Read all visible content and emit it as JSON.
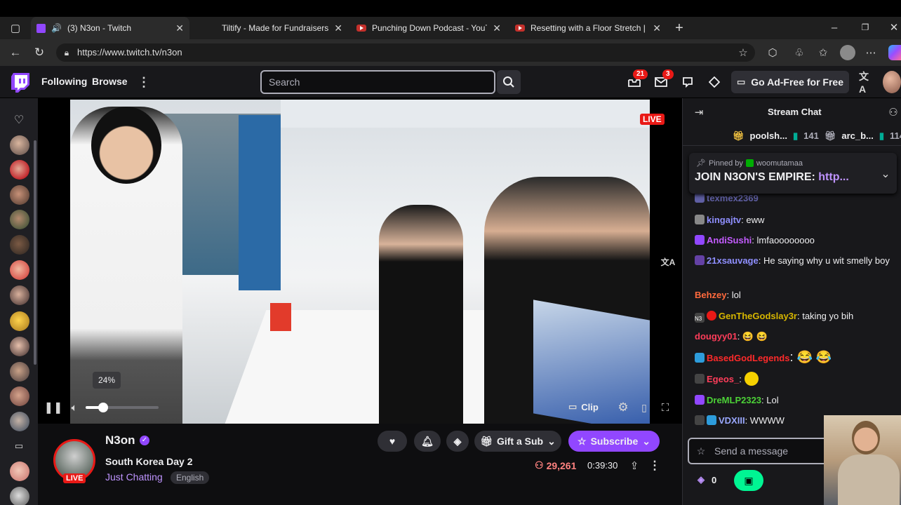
{
  "browser": {
    "tabs": [
      {
        "title": "(3) N3on - Twitch",
        "active": true,
        "favicon": "twitch-icon"
      },
      {
        "title": "Tiltify - Made for Fundraisers",
        "active": false,
        "favicon": "tiltify-icon"
      },
      {
        "title": "Punching Down Podcast - YouTub",
        "active": false,
        "favicon": "youtube-icon"
      },
      {
        "title": "Resetting with a Floor Stretch | Za",
        "active": false,
        "favicon": "youtube-icon"
      }
    ],
    "url": "https://www.twitch.tv/n3on"
  },
  "twitch_nav": {
    "following": "Following",
    "browse": "Browse",
    "search_placeholder": "Search",
    "notifications_count": "21",
    "inbox_count": "3",
    "ad_free": "Go Ad-Free for Free"
  },
  "player": {
    "live_badge": "LIVE",
    "volume_tooltip": "24%",
    "volume_level": 0.24,
    "clip_label": "Clip"
  },
  "channel": {
    "name": "N3on",
    "title": "South Korea Day 2",
    "category": "Just Chatting",
    "tag": "English",
    "live_badge": "LIVE",
    "viewers": "29,261",
    "uptime": "0:39:30",
    "gift_sub": "Gift a Sub",
    "subscribe": "Subscribe"
  },
  "chat": {
    "header": "Stream Chat",
    "gifters": [
      {
        "name": "poolsh...",
        "count": "141"
      },
      {
        "name": "arc_b...",
        "count": "114"
      }
    ],
    "pinned_by_label": "Pinned by",
    "pinned_by_user": "woomutamaa",
    "pinned_text": "JOIN N3ON'S EMPIRE: ",
    "pinned_link": "http...",
    "partial_user": "texmex2369",
    "messages": [
      {
        "user": "kingajtv",
        "text": ": eww",
        "color": "#8f8fff"
      },
      {
        "user": "AndiSushi",
        "text": ": lmfaoooooooo",
        "color": "#c45cff"
      },
      {
        "user": "21xsauvage",
        "text": ": He saying why u wit smelly boy",
        "color": "#8f8fff"
      },
      {
        "user": "Behzey",
        "text": ": lol",
        "color": "#ff6a3d"
      },
      {
        "user": "GenTheGodslay3r",
        "text": ": taking yo bih",
        "color": "#d7b600"
      },
      {
        "user": "dougyy01",
        "text": ": 😆 😆",
        "color": "#ff3d5a"
      },
      {
        "user": "BasedGodLegends",
        "text": ": 😂 😂",
        "color": "#ff2a2a"
      },
      {
        "user": "Egeos_",
        "text": ":",
        "color": "#ff3d5a"
      },
      {
        "user": "DreMLP2323",
        "text": ": Lol",
        "color": "#4cd137"
      },
      {
        "user": "VDXIII",
        "text": ": WWWW",
        "color": "#9aa8ff"
      }
    ],
    "send_placeholder": "Send a message",
    "points": "0"
  },
  "colors": {
    "twitch_purple": "#9147ff",
    "live_red": "#e91916",
    "chat_bg": "#18181b"
  }
}
